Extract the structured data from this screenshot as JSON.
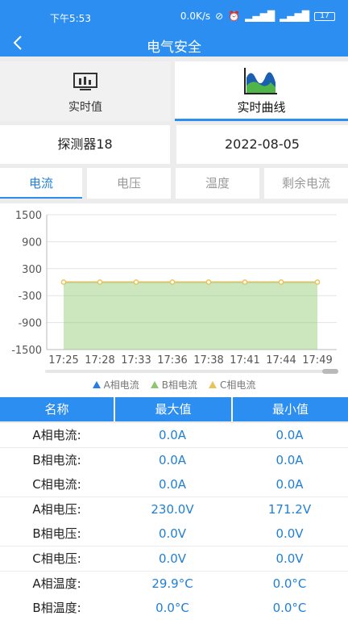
{
  "status_bar": {
    "time": "下午5:53",
    "net_speed": "0.0K/s",
    "battery": "17"
  },
  "header": {
    "title": "电气安全"
  },
  "top_tabs": [
    {
      "label": "实时值",
      "icon": "realtime-value-icon"
    },
    {
      "label": "实时曲线",
      "icon": "area-chart-icon"
    }
  ],
  "selectors": {
    "detector": "探测器18",
    "date": "2022-08-05"
  },
  "sub_tabs": [
    "电流",
    "电压",
    "温度",
    "剩余电流"
  ],
  "active_sub_tab": 0,
  "colors": {
    "accent": "#2b8ef0",
    "series_a": "#2a7de1",
    "series_b": "#8fc76f",
    "series_c": "#e8c25a"
  },
  "chart_data": {
    "type": "area",
    "categories": [
      "17:25",
      "17:28",
      "17:33",
      "17:36",
      "17:38",
      "17:41",
      "17:44",
      "17:49"
    ],
    "series": [
      {
        "name": "A相电流",
        "values": [
          0,
          0,
          0,
          0,
          0,
          0,
          0,
          0
        ],
        "color": "#2a7de1"
      },
      {
        "name": "B相电流",
        "values": [
          0,
          0,
          0,
          0,
          0,
          0,
          0,
          0
        ],
        "color": "#8fc76f"
      },
      {
        "name": "C相电流",
        "values": [
          0,
          0,
          0,
          0,
          0,
          0,
          0,
          0
        ],
        "color": "#e8c25a"
      }
    ],
    "y_ticks": [
      "1500",
      "900",
      "300",
      "-300",
      "-900",
      "-1500"
    ],
    "ylim": [
      -1500,
      1500
    ],
    "grid": true,
    "legend": "bottom"
  },
  "table": {
    "headers": [
      "名称",
      "最大值",
      "最小值"
    ],
    "rows": [
      [
        "A相电流:",
        "0.0A",
        "0.0A"
      ],
      [
        "B相电流:",
        "0.0A",
        "0.0A"
      ],
      [
        "C相电流:",
        "0.0A",
        "0.0A"
      ],
      [
        "A相电压:",
        "230.0V",
        "171.2V"
      ],
      [
        "B相电压:",
        "0.0V",
        "0.0V"
      ],
      [
        "C相电压:",
        "0.0V",
        "0.0V"
      ],
      [
        "A相温度:",
        "29.9°C",
        "0.0°C"
      ],
      [
        "B相温度:",
        "0.0°C",
        "0.0°C"
      ]
    ]
  }
}
